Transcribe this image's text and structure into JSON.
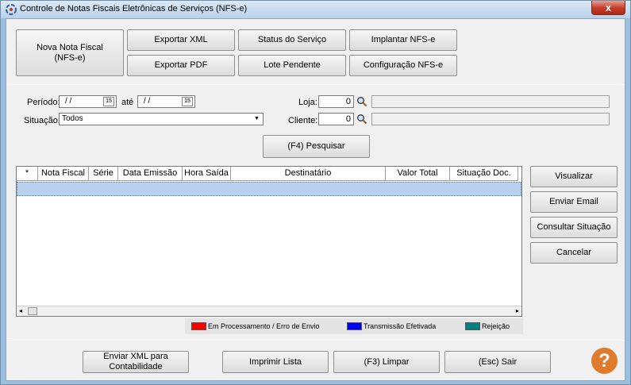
{
  "window": {
    "title": "Controle de Notas Fiscais Eletrônicas de Serviços (NFS-e)",
    "close": "x"
  },
  "toolbar": {
    "nova_nota": "Nova Nota Fiscal (NFS-e)",
    "exportar_xml": "Exportar XML",
    "exportar_pdf": "Exportar PDF",
    "status_servico": "Status do Serviço",
    "lote_pendente": "Lote Pendente",
    "implantar": "Implantar NFS-e",
    "configuracao": "Configuração NFS-e"
  },
  "filters": {
    "periodo_label": "Período:",
    "periodo_de": "/ /",
    "ate_label": "até",
    "periodo_ate": "/ /",
    "cal_label": "15",
    "situacao_label": "Situação:",
    "situacao_value": "Todos",
    "loja_label": "Loja:",
    "loja_value": "0",
    "loja_desc": "",
    "cliente_label": "Cliente:",
    "cliente_value": "0",
    "cliente_desc": "",
    "pesquisar": "(F4) Pesquisar"
  },
  "grid": {
    "columns": [
      "*",
      "Nota Fiscal",
      "Série",
      "Data Emissão",
      "Hora Saída",
      "Destinatário",
      "Valor Total",
      "Situação Doc."
    ]
  },
  "side_buttons": {
    "visualizar": "Visualizar",
    "enviar_email": "Enviar Email",
    "consultar": "Consultar Situação",
    "cancelar": "Cancelar"
  },
  "legend": [
    {
      "label": "Em Processamento / Erro de Envio",
      "color": "#ff0000"
    },
    {
      "label": "Transmissão Efetivada",
      "color": "#0000ff"
    },
    {
      "label": "Rejeição",
      "color": "#008080"
    }
  ],
  "bottom": {
    "enviar_xml": "Enviar XML para Contabilidade",
    "imprimir": "Imprimir Lista",
    "limpar": "(F3) Limpar",
    "sair": "(Esc) Sair",
    "help": "?"
  }
}
